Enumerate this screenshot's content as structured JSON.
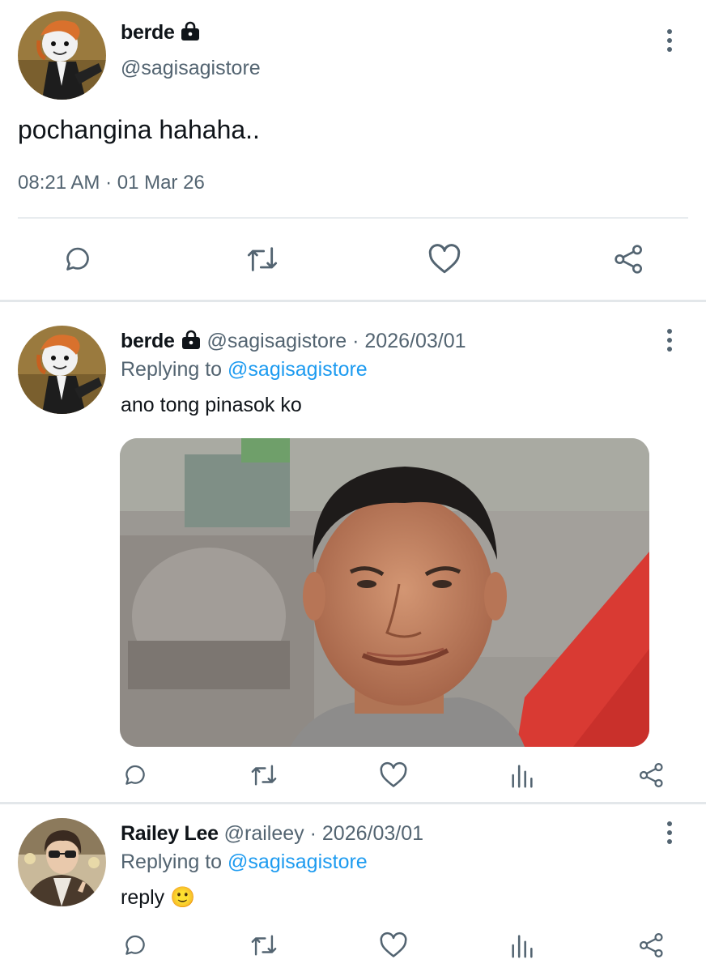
{
  "main_tweet": {
    "display_name": "berde",
    "handle": "@sagisagistore",
    "text": "pochangina hahaha..",
    "timestamp": "08:21 AM · 01 Mar 26",
    "avatar_icon": "avatar-image",
    "actions": [
      "reply-icon",
      "retweet-icon",
      "like-icon",
      "share-icon"
    ]
  },
  "replies": [
    {
      "display_name": "berde",
      "handle_date": "@sagisagistore · 2026/03/01",
      "replying_prefix": "Replying to ",
      "replying_to": "@sagisagistore",
      "text": "ano tong pinasok ko",
      "has_media": true,
      "actions": [
        "reply-icon",
        "retweet-icon",
        "like-icon",
        "views-icon",
        "share-icon"
      ]
    },
    {
      "display_name": "Railey Lee",
      "handle_date": "@raileey · 2026/03/01",
      "replying_prefix": "Replying to ",
      "replying_to": "@sagisagistore",
      "text": "reply 🙂",
      "has_media": false,
      "actions": [
        "reply-icon",
        "retweet-icon",
        "like-icon",
        "views-icon",
        "share-icon"
      ]
    }
  ],
  "colors": {
    "text": "#0f1419",
    "secondary": "#536471",
    "link": "#1d9bf0",
    "divider": "#e3e7ea"
  }
}
